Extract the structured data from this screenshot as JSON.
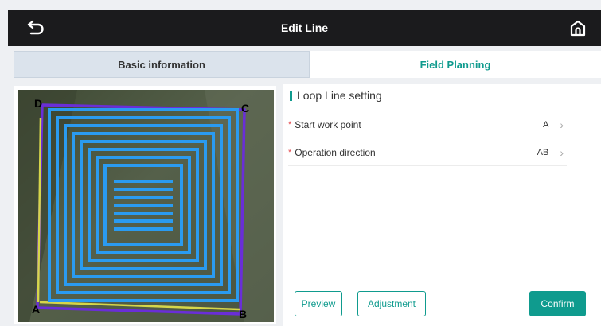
{
  "header": {
    "title": "Edit Line",
    "back_icon": "back-arrow-icon",
    "home_icon": "home-icon"
  },
  "tabs": [
    {
      "label": "Basic information",
      "active": false
    },
    {
      "label": "Field Planning",
      "active": true
    }
  ],
  "map": {
    "corner_labels": {
      "A": "A",
      "B": "B",
      "C": "C",
      "D": "D"
    }
  },
  "panel": {
    "section_title": "Loop Line setting",
    "rows": [
      {
        "label": "Start work point",
        "value": "A"
      },
      {
        "label": "Operation direction",
        "value": "AB"
      }
    ],
    "buttons": {
      "preview": "Preview",
      "adjustment": "Adjustment",
      "confirm": "Confirm"
    }
  },
  "colors": {
    "accent": "#0f9b8e",
    "header_bg": "#1b1b1d",
    "path_line": "#2a9bf0",
    "boundary": "#6a2ed8",
    "required_star": "#e5484d"
  }
}
